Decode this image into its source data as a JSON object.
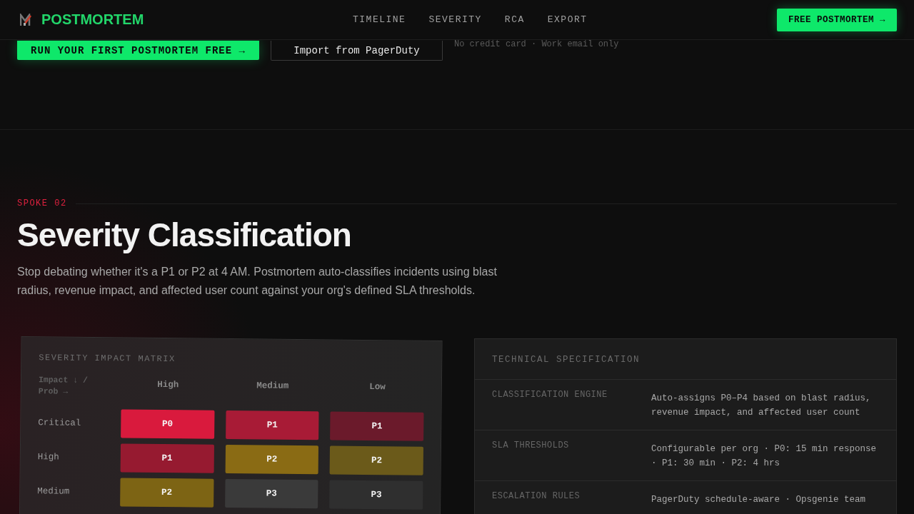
{
  "header": {
    "brand": "POSTMORTEM",
    "nav": [
      {
        "label": "TIMELINE"
      },
      {
        "label": "SEVERITY"
      },
      {
        "label": "RCA"
      },
      {
        "label": "EXPORT"
      }
    ],
    "cta": "FREE POSTMORTEM →"
  },
  "hero": {
    "primary": "RUN YOUR FIRST POSTMORTEM FREE →",
    "secondary": "Import from PagerDuty",
    "note": "No credit card · Work email only"
  },
  "section": {
    "eyebrow": "SPOKE 02",
    "title": "Severity Classification",
    "lead": "Stop debating whether it's a P1 or P2 at 4 AM. Postmortem auto-classifies incidents using blast radius, revenue impact, and affected user count against your org's defined SLA thresholds."
  },
  "matrix": {
    "title": "SEVERITY IMPACT MATRIX",
    "corner": "Impact ↓ / Prob →",
    "columns": [
      "High",
      "Medium",
      "Low"
    ],
    "rows": [
      {
        "label": "Critical",
        "cells": [
          {
            "text": "P0",
            "color": "#d91a3d"
          },
          {
            "text": "P1",
            "color": "#a81b36"
          },
          {
            "text": "P1",
            "color": "#6b1a2b"
          }
        ]
      },
      {
        "label": "High",
        "cells": [
          {
            "text": "P1",
            "color": "#961a30"
          },
          {
            "text": "P2",
            "color": "#8a6b14"
          },
          {
            "text": "P2",
            "color": "#6b5a1a"
          }
        ]
      },
      {
        "label": "Medium",
        "cells": [
          {
            "text": "P2",
            "color": "#7d6414"
          },
          {
            "text": "P3",
            "color": "#3a3a3a"
          },
          {
            "text": "P3",
            "color": "#2f2f2f"
          }
        ]
      }
    ]
  },
  "spec": {
    "title": "TECHNICAL SPECIFICATION",
    "rows": [
      {
        "key": "CLASSIFICATION ENGINE",
        "value": "Auto-assigns P0–P4 based on blast radius, revenue impact, and affected user count"
      },
      {
        "key": "SLA THRESHOLDS",
        "value": "Configurable per org · P0: 15 min response · P1: 30 min · P2: 4 hrs"
      },
      {
        "key": "ESCALATION RULES",
        "value": "PagerDuty schedule-aware · Opsgenie team"
      }
    ]
  }
}
